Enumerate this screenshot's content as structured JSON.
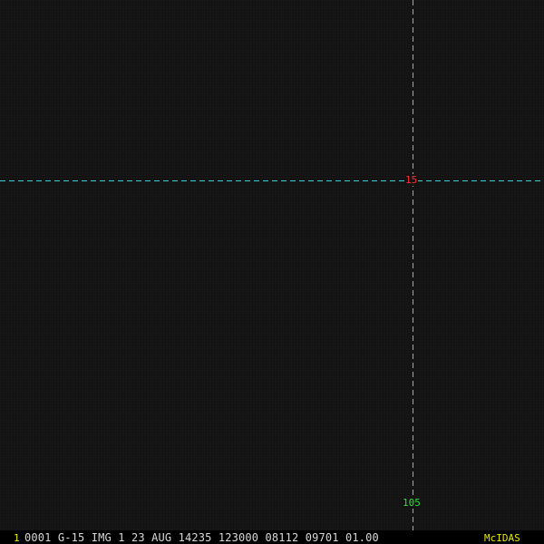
{
  "display": {
    "background_color": "#121212",
    "grid_color": "#3fd0d8"
  },
  "grid": {
    "latitude_label": "15",
    "latitude_label_color": "#ff3030",
    "longitude_label": "105",
    "longitude_label_color": "#30e030"
  },
  "status_bar": {
    "frame_number": "1",
    "frame_number_color": "#e8e800",
    "image_info": "0001 G-15 IMG   1 23 AUG 14235 123000 08112 09701 01.00",
    "image_info_color": "#d8d8d8",
    "brand": "McIDAS",
    "brand_color": "#e8e800"
  }
}
